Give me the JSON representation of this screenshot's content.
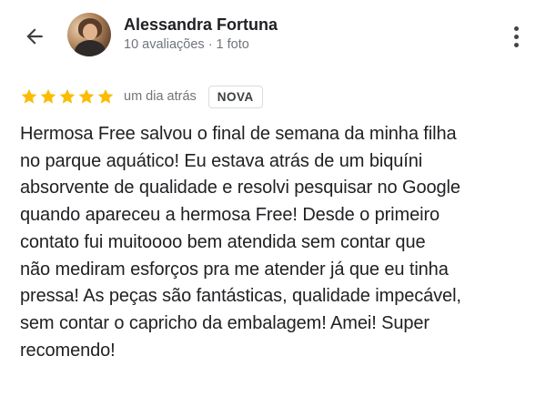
{
  "header": {
    "back_icon": "arrow-back-icon",
    "reviewer_name": "Alessandra Fortuna",
    "reviewer_stats": "10 avaliações · 1 foto",
    "more_icon": "more-vertical-icon"
  },
  "review": {
    "rating": 5,
    "rating_max": 5,
    "star_color": "#fbbc04",
    "time_ago": "um dia atrás",
    "badge": "NOVA",
    "lines": [
      "Hermosa Free salvou o final de semana da minha filha",
      "no parque aquático! Eu estava atrás de um biquíni",
      "absorvente de qualidade e resolvi pesquisar no Google",
      "quando apareceu a hermosa Free! Desde o primeiro",
      "contato fui muitoooo bem atendida sem contar que",
      "não mediram esforços pra me atender já que eu tinha",
      "pressa! As peças são fantásticas, qualidade impecável,",
      "sem contar o capricho da embalagem! Amei! Super",
      "recomendo!"
    ]
  }
}
